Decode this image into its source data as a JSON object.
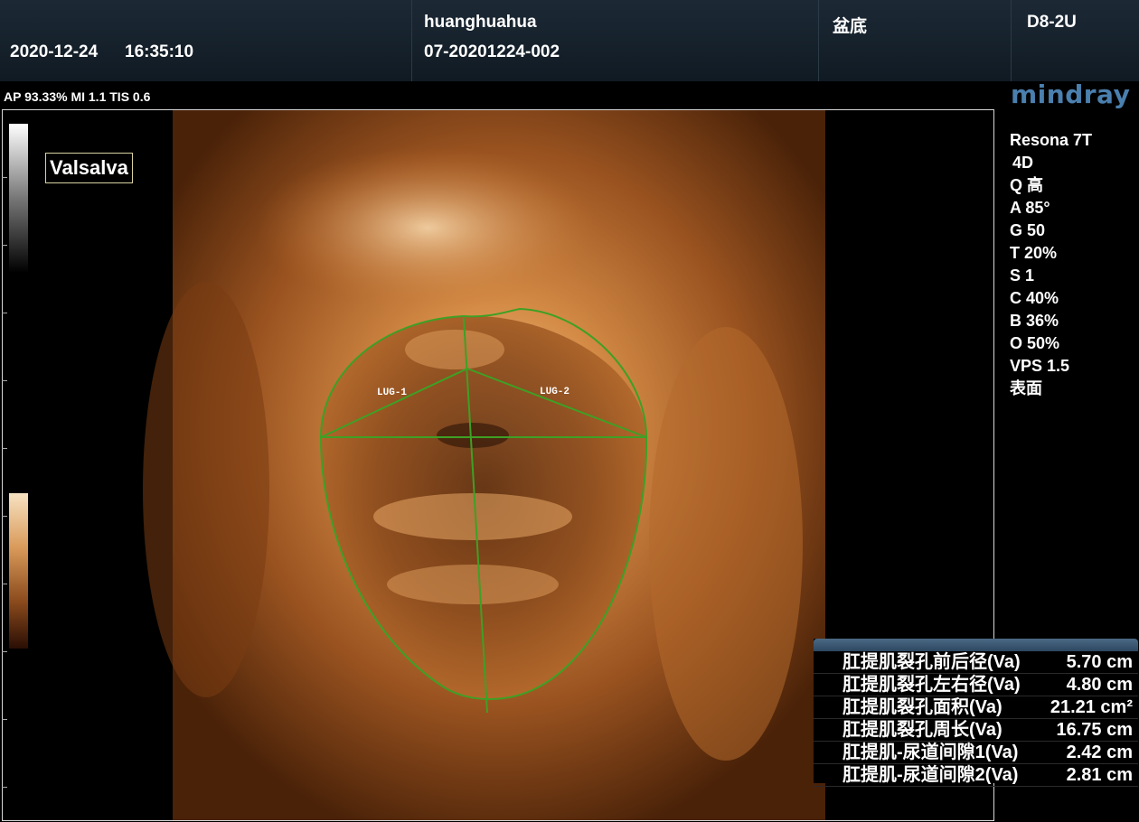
{
  "header": {
    "date": "2020-12-24",
    "time": "16:35:10",
    "patient_name": "huanghuahua",
    "patient_id": "07-20201224-002",
    "exam_type": "盆底",
    "probe": "D8-2U"
  },
  "power_info": "AP 93.33%  MI 1.1 TIS 0.6",
  "brand": {
    "logo": "mindray",
    "model": "Resona 7T"
  },
  "params": [
    "4D",
    "Q 高",
    "A 85°",
    "G 50",
    "T 20%",
    "S 1",
    "C 40%",
    "B 36%",
    "O 50%",
    "VPS 1.5",
    "表面"
  ],
  "image": {
    "label": "Valsalva",
    "annotations": [
      "LUG-1",
      "LUG-2"
    ],
    "trace_color": "#3ea025",
    "render_color": "#c9752f"
  },
  "measurements": [
    {
      "name": "肛提肌裂孔前后径(Va)",
      "value": "5.70 cm"
    },
    {
      "name": "肛提肌裂孔左右径(Va)",
      "value": "4.80 cm"
    },
    {
      "name": "肛提肌裂孔面积(Va)",
      "value": "21.21 cm²"
    },
    {
      "name": "肛提肌裂孔周长(Va)",
      "value": "16.75 cm"
    },
    {
      "name": "肛提肌-尿道间隙1(Va)",
      "value": "2.42 cm"
    },
    {
      "name": "肛提肌-尿道间隙2(Va)",
      "value": "2.81 cm"
    }
  ]
}
